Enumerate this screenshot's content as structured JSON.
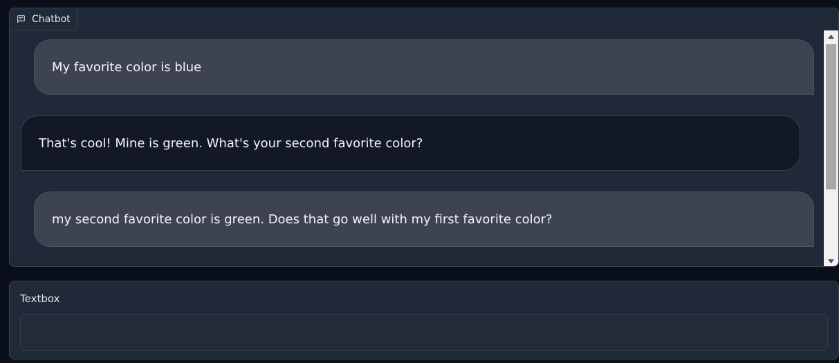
{
  "chatbot": {
    "label": "Chatbot",
    "label_icon": "chat-icon",
    "messages": [
      {
        "role": "user",
        "text": "My favorite color is blue"
      },
      {
        "role": "bot",
        "text": "That's cool! Mine is green. What's your second favorite color?"
      },
      {
        "role": "user",
        "text": "my second favorite color is green. Does that go well with my first favorite color?"
      }
    ]
  },
  "textbox": {
    "label": "Textbox",
    "value": "",
    "placeholder": ""
  },
  "colors": {
    "page_bg": "#0b0f19",
    "panel_bg": "#1f2937",
    "user_bubble": "#3d4351",
    "bot_bubble": "#131826",
    "text": "#f3f4f6"
  }
}
